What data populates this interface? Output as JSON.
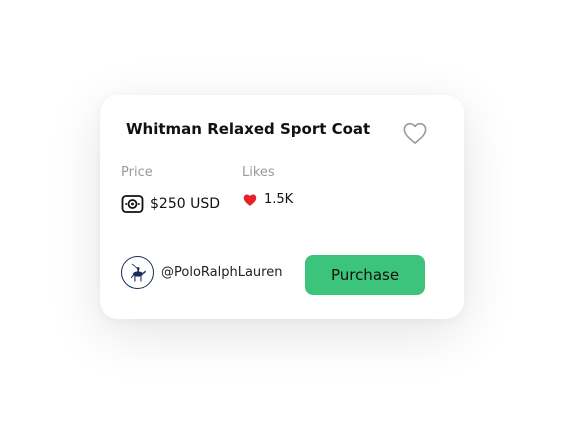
{
  "product": {
    "title": "Whitman Relaxed Sport Coat",
    "price_label": "Price",
    "price_value": "$250 USD",
    "likes_label": "Likes",
    "likes_value": "1.5K"
  },
  "seller": {
    "handle": "@PoloRalphLauren"
  },
  "actions": {
    "purchase_label": "Purchase"
  },
  "icons": {
    "favorite": "heart-outline-icon",
    "price": "money-bill-icon",
    "likes": "heart-filled-icon",
    "avatar": "polo-logo-avatar"
  },
  "colors": {
    "accent_green": "#3cc47c",
    "like_red": "#e8202a",
    "brand_navy": "#1d2b5b"
  }
}
